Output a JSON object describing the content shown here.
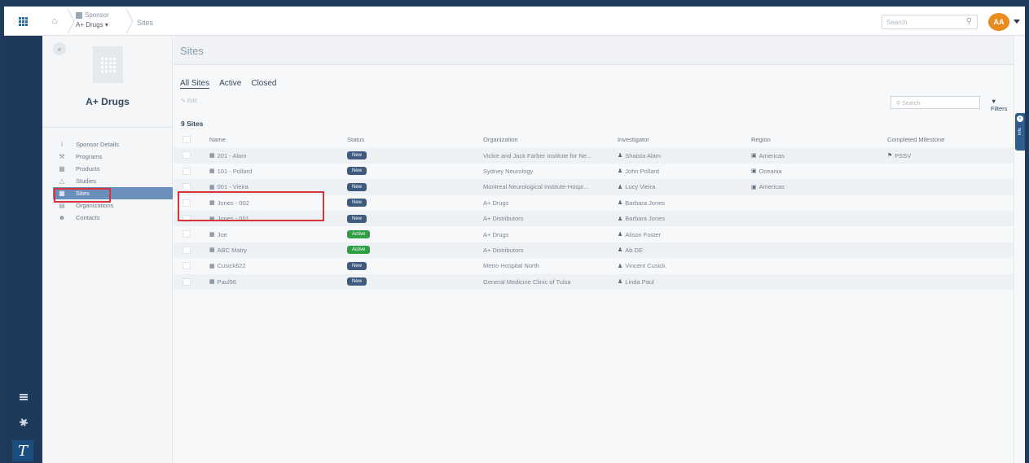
{
  "topbar": {
    "breadcrumb_sponsor_label": "Sponsor",
    "breadcrumb_sponsor_value": "A+ Drugs",
    "breadcrumb_sites": "Sites",
    "search_placeholder": "Search",
    "avatar_initials": "AA"
  },
  "panel": {
    "sponsor_name": "A+ Drugs",
    "menu": [
      {
        "label": "Sponsor Details",
        "icon": "info-icon"
      },
      {
        "label": "Programs",
        "icon": "programs-icon"
      },
      {
        "label": "Products",
        "icon": "products-icon"
      },
      {
        "label": "Studies",
        "icon": "flask-icon"
      },
      {
        "label": "Sites",
        "icon": "building-icon",
        "active": true
      },
      {
        "label": "Organizations",
        "icon": "organization-icon"
      },
      {
        "label": "Contacts",
        "icon": "contacts-icon"
      }
    ]
  },
  "main": {
    "title": "Sites",
    "tabs": [
      "All Sites",
      "Active",
      "Closed"
    ],
    "selected_tab": "All Sites",
    "edit_label": "Edit",
    "search_placeholder": "Search",
    "filters_label": "Filters",
    "count_label": "9 Sites",
    "info_tab_label": "Info"
  },
  "table": {
    "columns": [
      "Name",
      "Status",
      "Organization",
      "Investigator",
      "Region",
      "Completed Milestone"
    ],
    "rows": [
      {
        "name": "201 - Alam",
        "status": "New",
        "organization": "Vickie and Jack Farber Institute for Ne...",
        "investigator": "Shaista Alam",
        "region": "Americas",
        "milestone": "PSSV"
      },
      {
        "name": "101 - Pollard",
        "status": "New",
        "organization": "Sydney Neurology",
        "investigator": "John Pollard",
        "region": "Oceania",
        "milestone": ""
      },
      {
        "name": "001 - Vieira",
        "status": "New",
        "organization": "Montreal Neurological Institute-Hospi...",
        "investigator": "Lucy Vieira",
        "region": "Americas",
        "milestone": ""
      },
      {
        "name": "Jones - 002",
        "status": "New",
        "organization": "A+ Drugs",
        "investigator": "Barbara Jones",
        "region": "",
        "milestone": ""
      },
      {
        "name": "Jones - 001",
        "status": "New",
        "organization": "A+ Distributors",
        "investigator": "Barbara Jones",
        "region": "",
        "milestone": ""
      },
      {
        "name": "Joe",
        "status": "Active",
        "organization": "A+ Drugs",
        "investigator": "Alison Foster",
        "region": "",
        "milestone": ""
      },
      {
        "name": "ABC Matry",
        "status": "Active",
        "organization": "A+ Distributors",
        "investigator": "Ab DE",
        "region": "",
        "milestone": ""
      },
      {
        "name": "Cusick622",
        "status": "New",
        "organization": "Metro Hospital North",
        "investigator": "Vincent Cusick",
        "region": "",
        "milestone": ""
      },
      {
        "name": "Paul96",
        "status": "New",
        "organization": "General Medicine Clinic of Tulsa",
        "investigator": "Linda Paul",
        "region": "",
        "milestone": ""
      }
    ]
  },
  "colors": {
    "rail": "#1e3a5a",
    "active_menu": "#6a8fba",
    "badge_new": "#3e5a7e",
    "badge_active": "#2f9e44",
    "highlight": "#d6343c",
    "avatar": "#e98b1e"
  }
}
